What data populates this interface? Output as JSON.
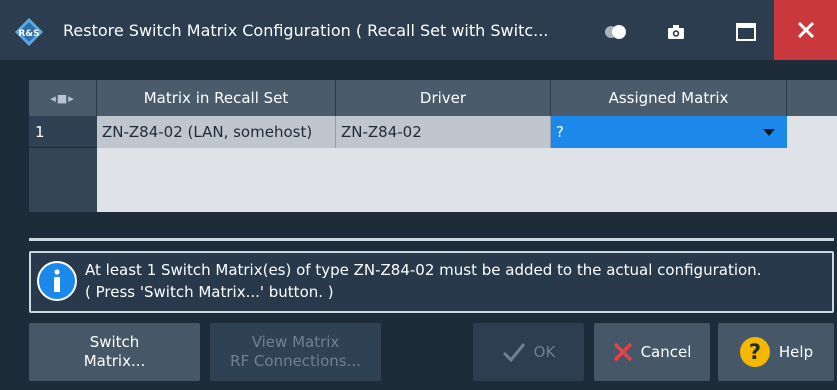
{
  "window": {
    "title": "Restore Switch Matrix Configuration  ( Recall Set with Switc..."
  },
  "table": {
    "columns": [
      "Matrix in Recall Set",
      "Driver",
      "Assigned Matrix"
    ],
    "rows": [
      {
        "index": "1",
        "matrix": "ZN-Z84-02 (LAN, somehost)",
        "driver": "ZN-Z84-02",
        "assigned": "?"
      }
    ]
  },
  "info": {
    "line1": "At least 1 Switch Matrix(es) of type ZN-Z84-02 must be added to the actual configuration.",
    "line2": "( Press 'Switch Matrix...' button. )"
  },
  "buttons": {
    "switch_matrix_line1": "Switch",
    "switch_matrix_line2": "Matrix...",
    "view_line1": "View Matrix",
    "view_line2": "RF Connections...",
    "ok": "OK",
    "cancel": "Cancel",
    "help": "Help"
  },
  "colors": {
    "accent": "#1c88ea",
    "close": "#c8383c",
    "help_icon": "#f5b800"
  },
  "icons": {
    "logo": "rohde-schwarz-logo-icon",
    "toggle": "toggle-icon",
    "camera": "camera-icon",
    "maximize": "maximize-icon",
    "close": "close-icon",
    "info": "info-icon",
    "ok": "checkmark-icon",
    "cancel": "x-icon",
    "help": "question-icon"
  }
}
